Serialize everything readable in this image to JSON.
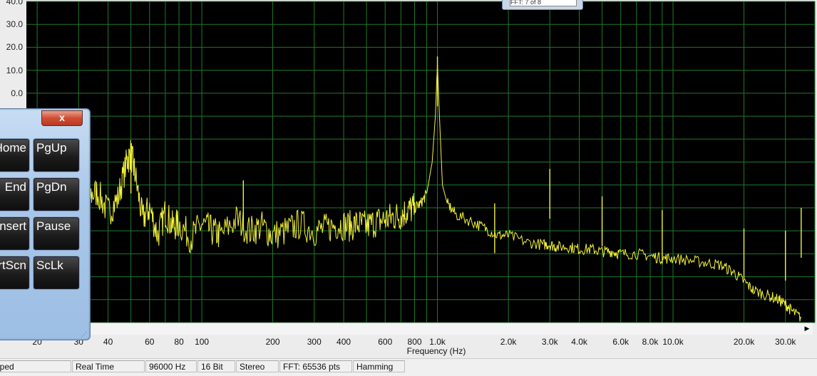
{
  "window": {
    "top_control_text": "FFT: 7 of 8"
  },
  "chart_data": {
    "type": "line",
    "title": "",
    "xlabel": "Frequency (Hz)",
    "ylabel": "",
    "x_scale": "log",
    "xlim": [
      18,
      40000
    ],
    "ylim": [
      -100,
      40
    ],
    "y_tick_labels": [
      "40.0",
      "30.0",
      "20.0",
      "10.0",
      "0.0"
    ],
    "y_ticks": [
      40,
      30,
      20,
      10,
      0
    ],
    "x_ticks": [
      20,
      30,
      40,
      60,
      80,
      100,
      200,
      300,
      400,
      600,
      800,
      1000,
      2000,
      3000,
      4000,
      6000,
      8000,
      10000,
      20000,
      30000
    ],
    "x_tick_labels": [
      "20",
      "30",
      "40",
      "60",
      "80",
      "100",
      "200",
      "300",
      "400",
      "600",
      "800",
      "1.0k",
      "2.0k",
      "3.0k",
      "4.0k",
      "6.0k",
      "8.0k",
      "10.0k",
      "20.0k",
      "30.0k"
    ],
    "grid": true,
    "colors": {
      "background": "#000000",
      "grid": "#1f7a2a",
      "trace": "#f2f23a"
    },
    "series": [
      {
        "values_x": [
          18,
          22,
          25,
          28,
          30,
          33,
          36,
          40,
          44,
          48,
          50,
          52,
          56,
          60,
          65,
          70,
          75,
          80,
          90,
          100,
          110,
          120,
          140,
          160,
          180,
          200,
          230,
          260,
          300,
          340,
          380,
          420,
          460,
          500,
          550,
          600,
          650,
          700,
          750,
          800,
          850,
          900,
          950,
          980,
          1000,
          1020,
          1050,
          1100,
          1200,
          1400,
          1600,
          1800,
          2000,
          2400,
          2800,
          3000,
          3200,
          3600,
          4000,
          4500,
          5000,
          5500,
          6000,
          7000,
          8000,
          9000,
          10000,
          12000,
          14000,
          16000,
          18000,
          20000,
          22000,
          25000,
          28000,
          30000,
          32000,
          35000
        ],
        "values_y": [
          -42,
          -38,
          -47,
          -40,
          -38,
          -45,
          -43,
          -52,
          -46,
          -30,
          -26,
          -35,
          -55,
          -50,
          -62,
          -52,
          -58,
          -57,
          -63,
          -57,
          -60,
          -62,
          -55,
          -60,
          -58,
          -62,
          -60,
          -57,
          -60,
          -59,
          -57,
          -58,
          -57,
          -58,
          -56,
          -55,
          -54,
          -53,
          -51,
          -50,
          -48,
          -44,
          -30,
          -10,
          13,
          -10,
          -40,
          -48,
          -53,
          -56,
          -59,
          -62,
          -62,
          -65,
          -66,
          -66,
          -67,
          -67,
          -68,
          -68,
          -69,
          -69,
          -70,
          -70,
          -71,
          -72,
          -72,
          -73,
          -74,
          -75,
          -78,
          -82,
          -86,
          -88,
          -90,
          -92,
          -95,
          -98
        ]
      }
    ],
    "spikes": [
      {
        "x": 1000,
        "y": 16
      },
      {
        "x": 3000,
        "y": -33
      },
      {
        "x": 1750,
        "y": -48
      },
      {
        "x": 5000,
        "y": -45
      },
      {
        "x": 9000,
        "y": -51
      },
      {
        "x": 20000,
        "y": -59
      },
      {
        "x": 30000,
        "y": -60
      },
      {
        "x": 35000,
        "y": -50
      },
      {
        "x": 50,
        "y": -22
      },
      {
        "x": 150,
        "y": -38
      }
    ]
  },
  "keyboard": {
    "close_label": "x",
    "keys": [
      {
        "left": "Home",
        "right": "PgUp"
      },
      {
        "left": "End",
        "right": "PgDn"
      },
      {
        "left": "Insert",
        "right": "Pause"
      },
      {
        "left": "PrtScn",
        "right": "ScLk"
      }
    ]
  },
  "statusbar": {
    "state": "Stopped",
    "mode": "Real Time",
    "sample_rate": "96000 Hz",
    "bits": "16 Bit",
    "channels": "Stereo",
    "fft": "FFT: 65536 pts",
    "window": "Hamming"
  }
}
